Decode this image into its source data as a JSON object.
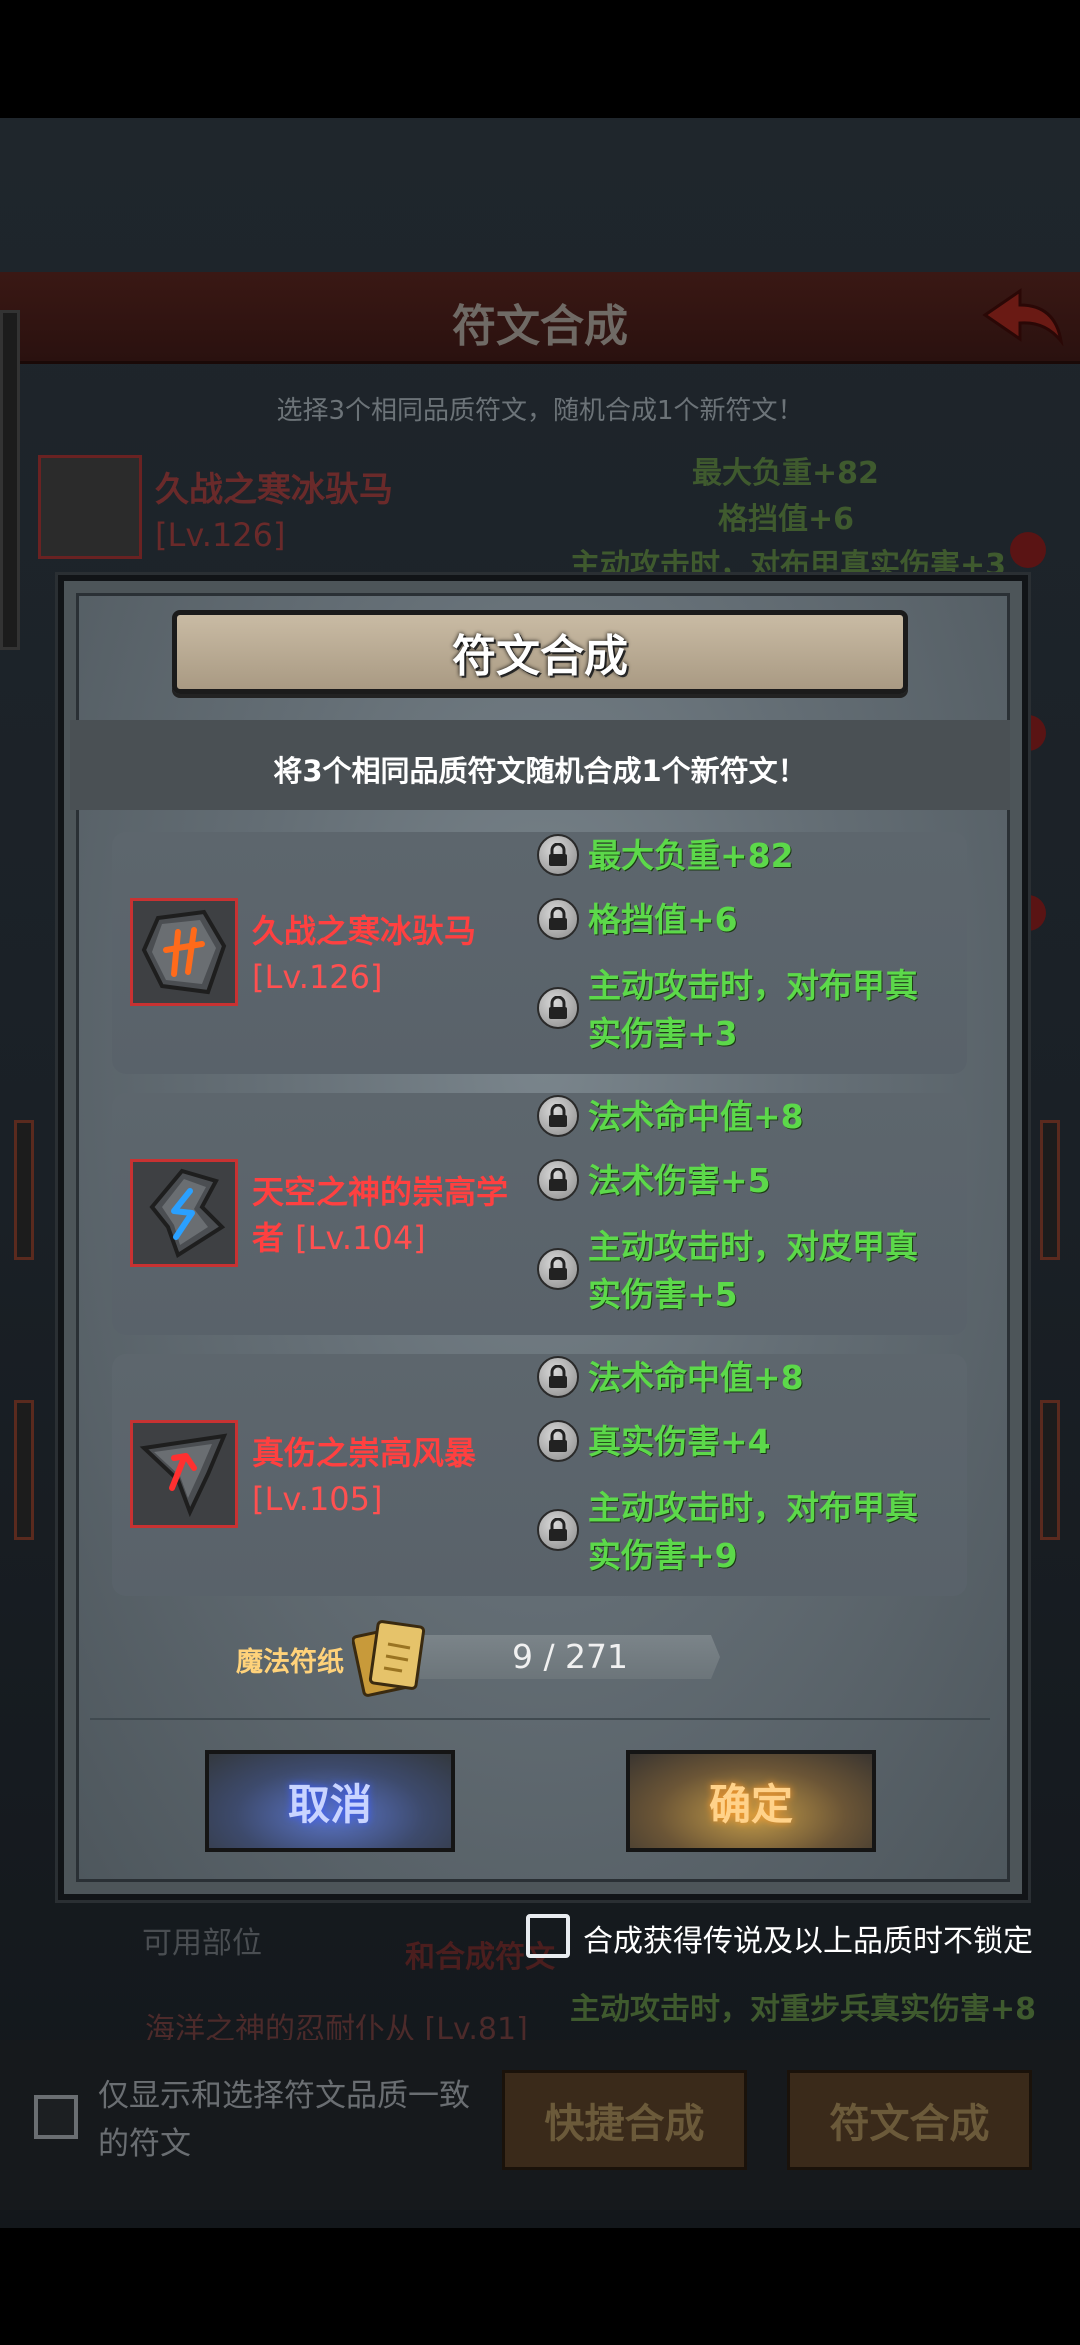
{
  "background": {
    "title": "符文合成",
    "subtitle": "选择3个相同品质符文，随机合成1个新符文！",
    "selected_rune": {
      "name": "久战之寒冰驮马",
      "level": "[Lv.126]"
    },
    "selected_stats": [
      "最大负重+82",
      "格挡值+6",
      "主动攻击时，对布甲真实伤害+3"
    ],
    "row_labels": {
      "slot_label": "可用部位",
      "merge_text": "和合成符文",
      "rune_list_name": "海洋之神的忍耐仆从",
      "rune_list_level": "[Lv.81]",
      "rune_list_stat": "主动攻击时，对重步兵真实伤害+8"
    },
    "filter_checkbox_label": "仅显示和选择符文品质一致的符文",
    "quick_merge_button": "快捷合成",
    "merge_button": "符文合成"
  },
  "dialog": {
    "title": "符文合成",
    "hint": "将3个相同品质符文随机合成1个新符文！",
    "runes": [
      {
        "name": "久战之寒冰驮马",
        "level": "[Lv.126]",
        "icon": "rune-stone-icon",
        "glyph_color": "#ff6a1a",
        "stats": [
          "最大负重+82",
          "格挡值+6",
          "主动攻击时，对布甲真实伤害+3"
        ]
      },
      {
        "name": "天空之神的崇高学者",
        "level": "[Lv.104]",
        "icon": "rune-shard-icon",
        "glyph_color": "#2aa0ff",
        "stats": [
          "法术命中值+8",
          "法术伤害+5",
          "主动攻击时，对皮甲真实伤害+5"
        ]
      },
      {
        "name": "真伤之崇高风暴",
        "level": "[Lv.105]",
        "icon": "rune-arrow-icon",
        "glyph_color": "#ff3030",
        "stats": [
          "法术命中值+8",
          "真实伤害+4",
          "主动攻击时，对布甲真实伤害+9"
        ]
      }
    ],
    "magic_paper_label": "魔法符纸",
    "magic_paper_count": "9 / 271",
    "cancel_label": "取消",
    "confirm_label": "确定",
    "lock_option_label": "合成获得传说及以上品质时不锁定"
  },
  "colors": {
    "rune_name": "#ff4040",
    "stat_text": "#5cd94a",
    "paper_label": "#ffd27a"
  }
}
